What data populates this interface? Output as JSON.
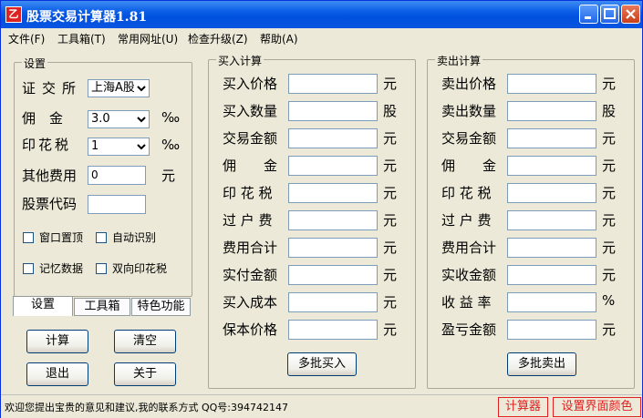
{
  "window": {
    "title": "股票交易计算器1.81"
  },
  "menu": [
    "文件(F)",
    "工具箱(T)",
    "常用网址(U)",
    "检查升级(Z)",
    "帮助(A)"
  ],
  "settings": {
    "title": "设置",
    "exchange_label": "证交所",
    "exchange_value": "上海A股",
    "commission_label": "佣　金",
    "commission_value": "3.0",
    "commission_unit": "‰",
    "stamp_label": "印花税",
    "stamp_value": "1",
    "stamp_unit": "‰",
    "other_label": "其他费用",
    "other_value": "0",
    "other_unit": "元",
    "code_label": "股票代码",
    "chk_top": "窗口置顶",
    "chk_auto": "自动识别",
    "chk_memory": "记忆数据",
    "chk_double": "双向印花税"
  },
  "tabs": [
    "设置",
    "工具箱",
    "特色功能"
  ],
  "buttons": {
    "calc": "计算",
    "clear": "清空",
    "exit": "退出",
    "about": "关于"
  },
  "buy": {
    "title": "买入计算",
    "rows": [
      {
        "label": "买入价格",
        "unit": "元"
      },
      {
        "label": "买入数量",
        "unit": "股"
      },
      {
        "label": "交易金额",
        "unit": "元"
      },
      {
        "label": "佣　　金",
        "unit": "元"
      },
      {
        "label": "印 花 税",
        "unit": "元"
      },
      {
        "label": "过 户 费",
        "unit": "元"
      },
      {
        "label": "费用合计",
        "unit": "元"
      },
      {
        "label": "实付金额",
        "unit": "元"
      },
      {
        "label": "买入成本",
        "unit": "元"
      },
      {
        "label": "保本价格",
        "unit": "元"
      }
    ],
    "button": "多批买入"
  },
  "sell": {
    "title": "卖出计算",
    "rows": [
      {
        "label": "卖出价格",
        "unit": "元"
      },
      {
        "label": "卖出数量",
        "unit": "股"
      },
      {
        "label": "交易金额",
        "unit": "元"
      },
      {
        "label": "佣　　金",
        "unit": "元"
      },
      {
        "label": "印 花 税",
        "unit": "元"
      },
      {
        "label": "过 户 费",
        "unit": "元"
      },
      {
        "label": "费用合计",
        "unit": "元"
      },
      {
        "label": "实收金额",
        "unit": "元"
      },
      {
        "label": "收 益 率",
        "unit": "%"
      },
      {
        "label": "盈亏金额",
        "unit": "元"
      }
    ],
    "button": "多批卖出"
  },
  "status": {
    "text": "欢迎您提出宝贵的意见和建议,我的联系方式 QQ号:394742147",
    "calc_button": "计算器",
    "color_button": "设置界面颜色"
  }
}
